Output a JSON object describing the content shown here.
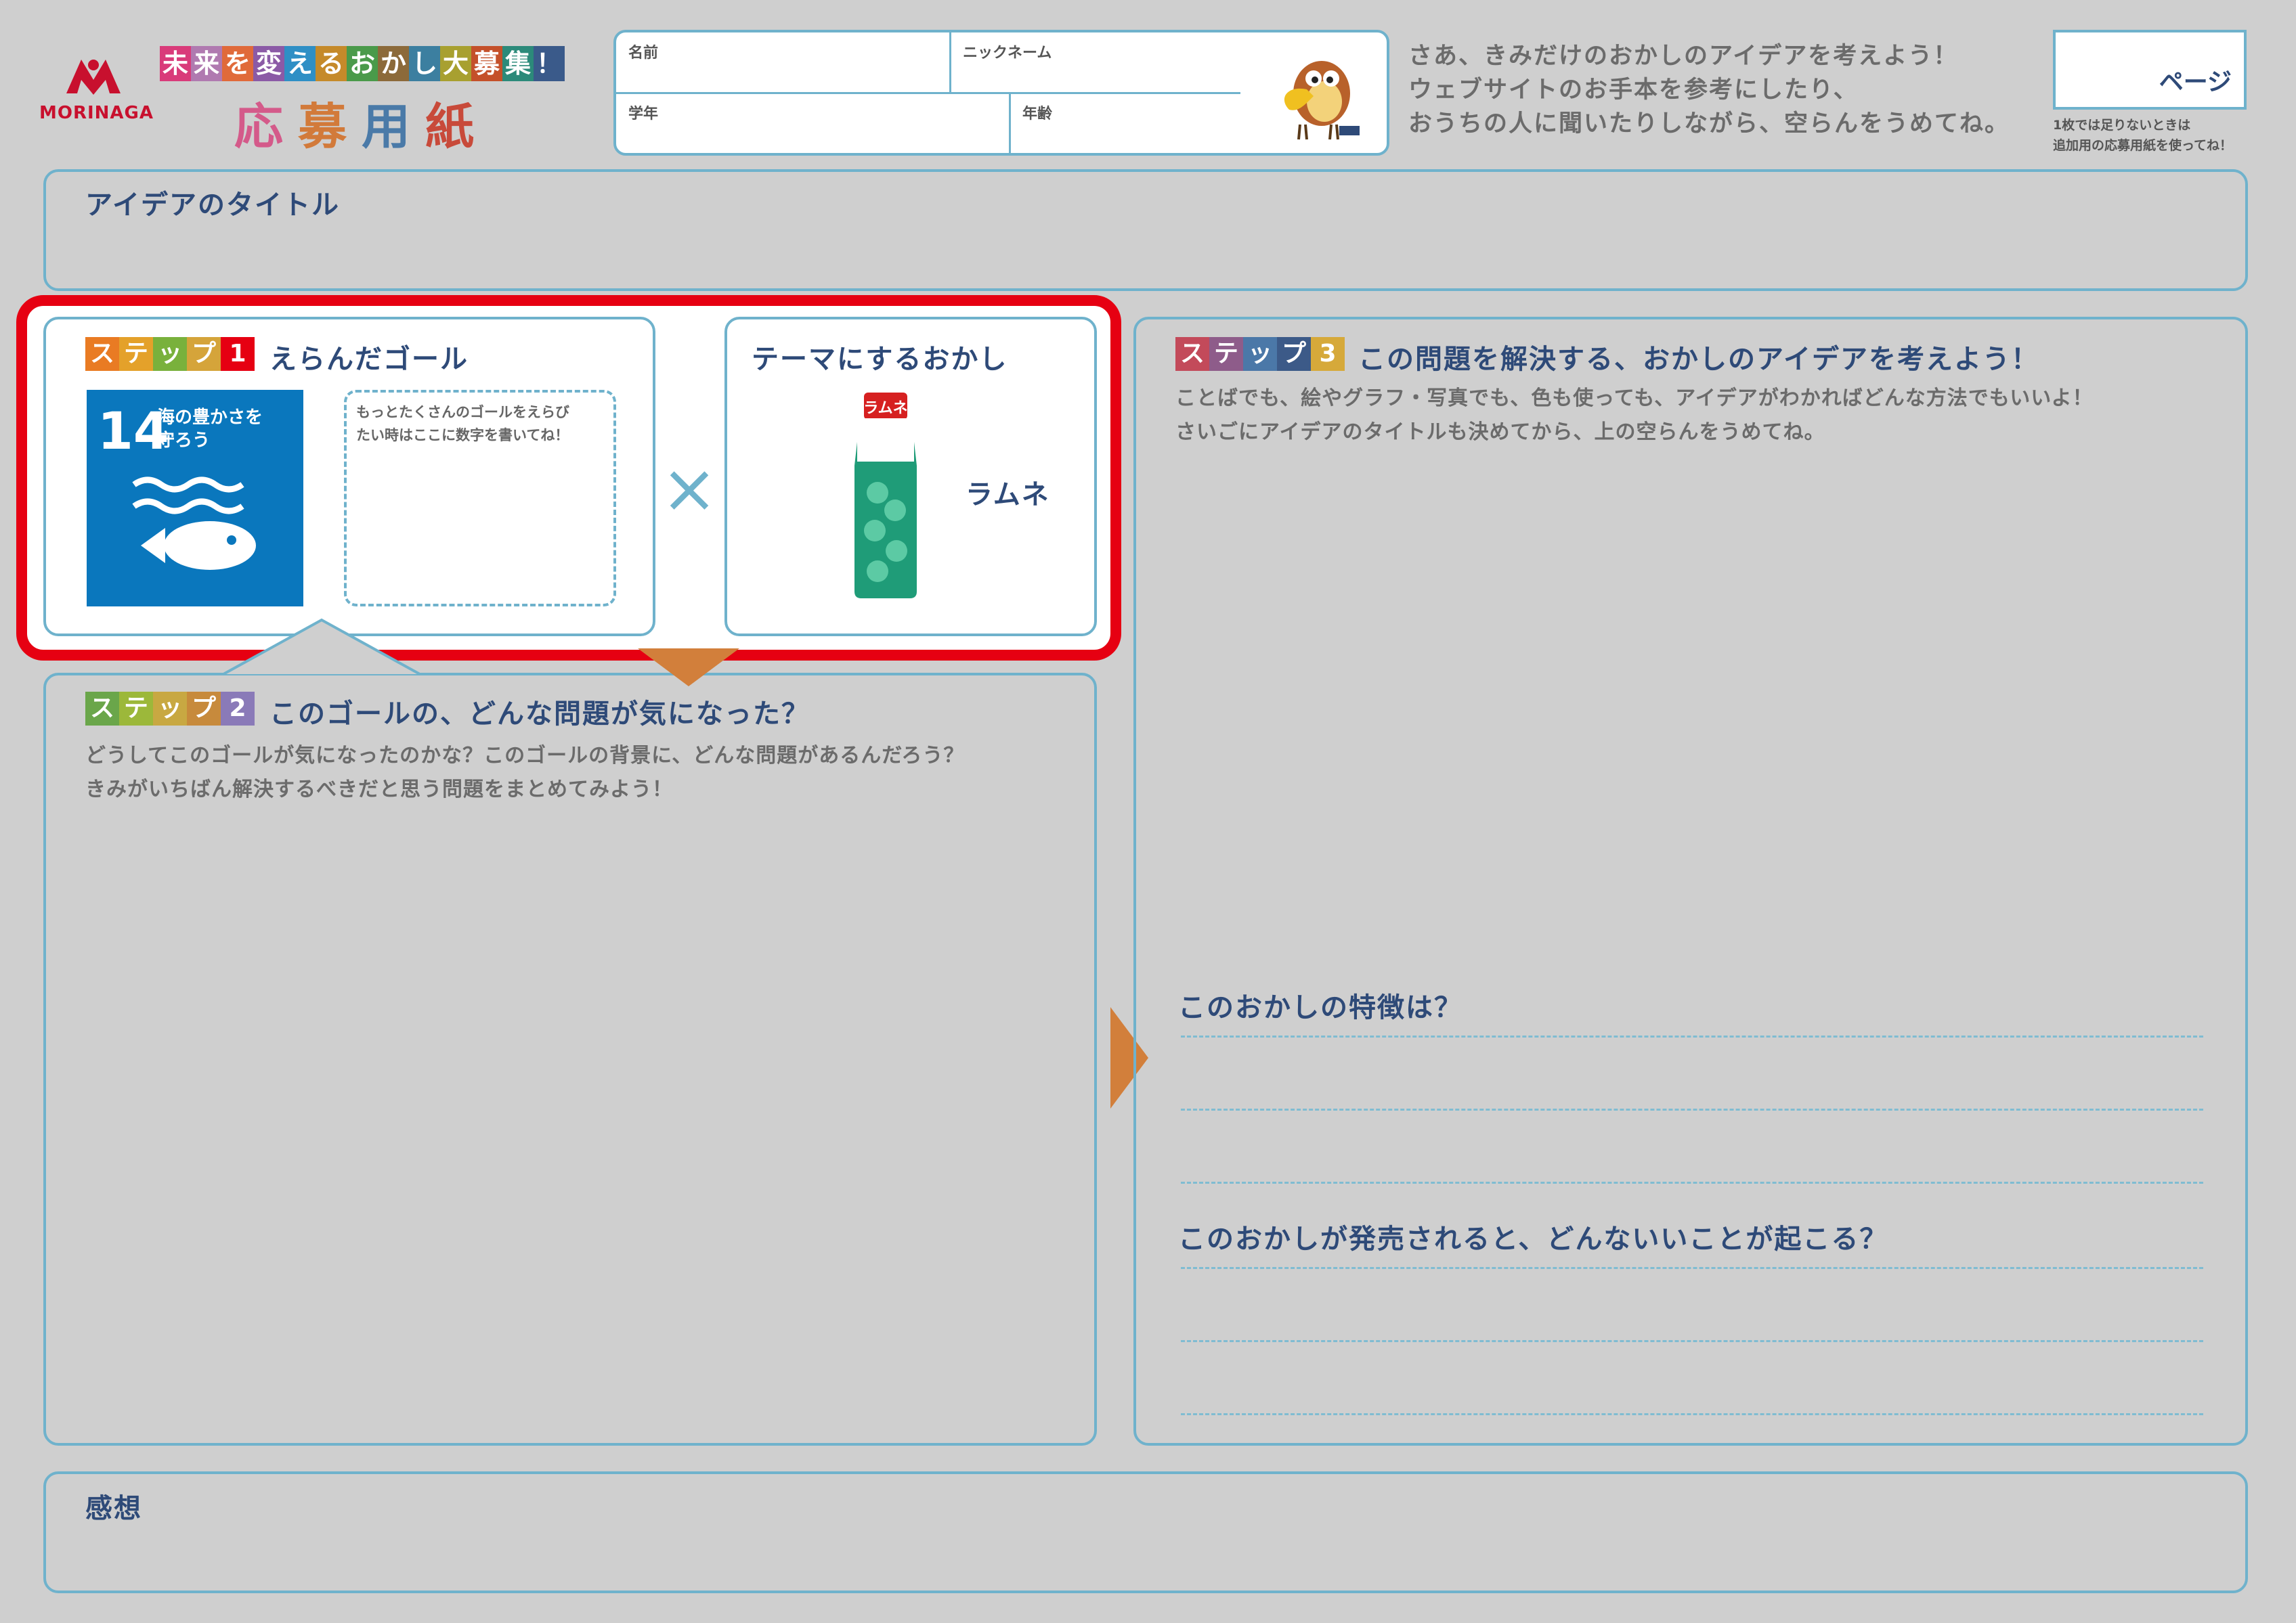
{
  "header": {
    "brand": "MORINAGA",
    "campaign": "未来を変えるおかし大募集！",
    "campaign_chars": [
      "未",
      "来",
      "を",
      "変",
      "え",
      "る",
      "お",
      "か",
      "し",
      "大",
      "募",
      "集",
      "！"
    ],
    "form_title_chars": [
      "応",
      "募",
      "用",
      "紙"
    ],
    "fields": {
      "name": "名前",
      "nickname": "ニックネーム",
      "grade": "学年",
      "age": "年齢"
    },
    "intro_line1": "さあ、きみだけのおかしのアイデアを考えよう！",
    "intro_line2": "ウェブサイトのお手本を参考にしたり、",
    "intro_line3": "おうちの人に聞いたりしながら、空らんをうめてね。",
    "page_label": "ページ",
    "page_note1": "1枚では足りないときは",
    "page_note2": "追加用の応募用紙を使ってね！"
  },
  "idea_title": {
    "label": "アイデアのタイトル"
  },
  "step1": {
    "step_chars": [
      "ス",
      "テ",
      "ッ",
      "プ"
    ],
    "step_num": "1",
    "title": "えらんだゴール",
    "sdg_number": "14",
    "sdg_line1": "海の豊かさを",
    "sdg_line2": "守ろう",
    "note_line1": "もっとたくさんのゴールをえらび",
    "note_line2": "たい時はここに数字を書いてね！",
    "times": "×"
  },
  "theme": {
    "title": "テーマにするおかし",
    "candy_name": "ラムネ",
    "bottle_label": "ラムネ"
  },
  "step2": {
    "step_chars": [
      "ス",
      "テ",
      "ッ",
      "プ"
    ],
    "step_num": "2",
    "title": "このゴールの、どんな問題が気になった？",
    "desc_line1": "どうしてこのゴールが気になったのかな？このゴールの背景に、どんな問題があるんだろう？",
    "desc_line2": "きみがいちばん解決するべきだと思う問題をまとめてみよう！"
  },
  "step3": {
    "step_chars": [
      "ス",
      "テ",
      "ッ",
      "プ"
    ],
    "step_num": "3",
    "title": "この問題を解決する、おかしのアイデアを考えよう！",
    "desc_line1": "ことばでも、絵やグラフ・写真でも、色も使っても、アイデアがわかればどんな方法でもいいよ！",
    "desc_line2": "さいごにアイデアのタイトルも決めてから、上の空らんをうめてね。",
    "q1": "このおかしの特徴は？",
    "q2": "このおかしが発売されると、どんないいことが起こる？"
  },
  "impression": {
    "label": "感想"
  },
  "colors": {
    "border": "#6fb2cc",
    "highlight": "#e60012",
    "orange_arrow": "#d27f3b",
    "sdg14_blue": "#0a77bd",
    "navy_text": "#2e4a78"
  }
}
